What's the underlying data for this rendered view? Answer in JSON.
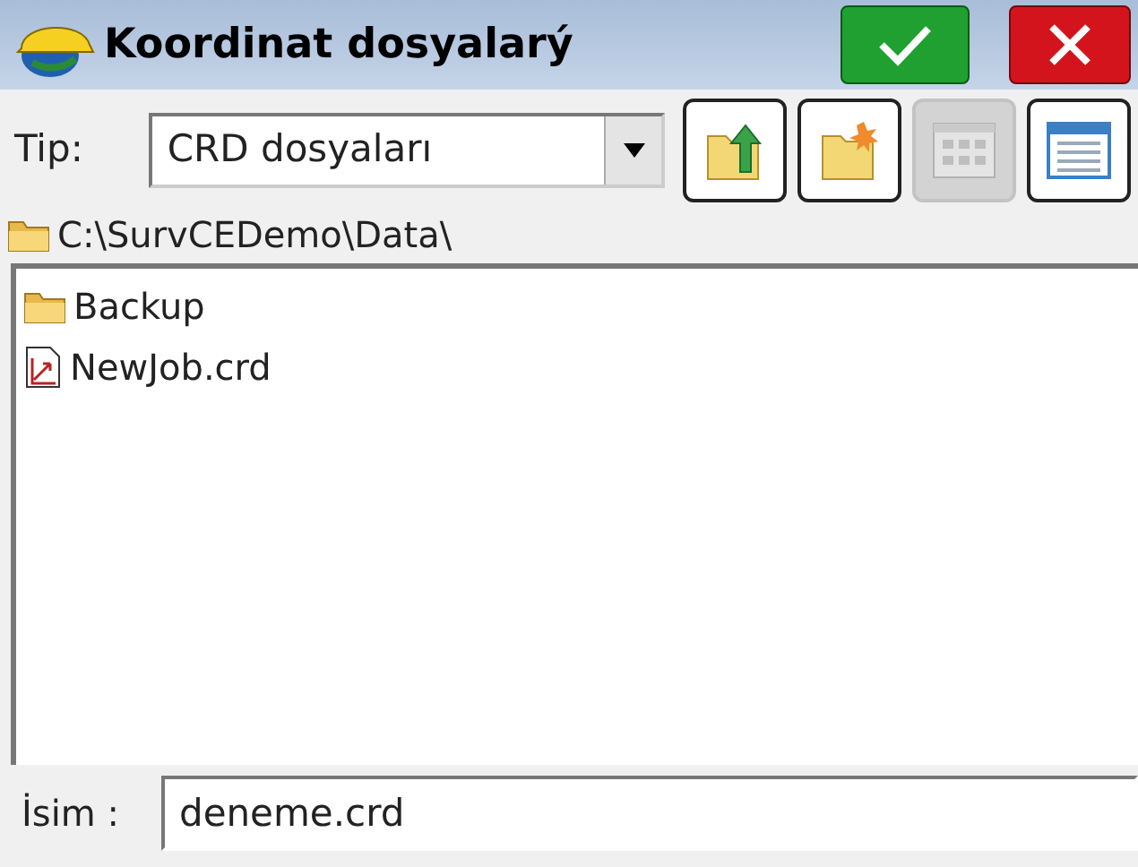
{
  "window": {
    "title": "Koordinat dosyalarý"
  },
  "type_filter": {
    "label": "Tip:",
    "value": "CRD dosyaları"
  },
  "toolbar": [
    {
      "kind": "up",
      "disabled": false
    },
    {
      "kind": "new_folder",
      "disabled": false
    },
    {
      "kind": "icons_view",
      "disabled": true
    },
    {
      "kind": "list_view",
      "disabled": false
    }
  ],
  "path": "C:\\SurvCEDemo\\Data\\",
  "files": [
    {
      "kind": "folder",
      "name": "Backup"
    },
    {
      "kind": "file",
      "name": "NewJob.crd"
    }
  ],
  "name_field": {
    "label": "İsim :",
    "value": "deneme.crd"
  }
}
